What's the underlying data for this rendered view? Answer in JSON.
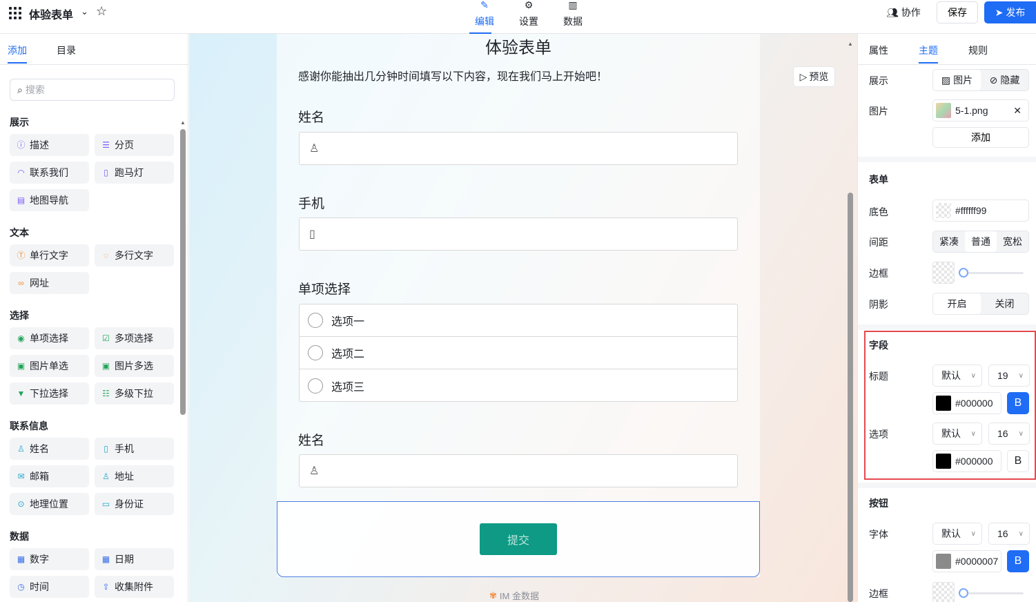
{
  "header": {
    "form_title": "体验表单",
    "tabs": [
      {
        "label": "编辑",
        "icon": "edit-icon"
      },
      {
        "label": "设置",
        "icon": "settings-icon"
      },
      {
        "label": "数据",
        "icon": "chart-icon"
      }
    ],
    "collab_label": "协作",
    "save_label": "保存",
    "publish_label": "发布"
  },
  "left": {
    "tabs": [
      "添加",
      "目录"
    ],
    "search_placeholder": "搜索",
    "sections": [
      {
        "title": "展示",
        "items": [
          {
            "label": "描述",
            "icon": "info-icon",
            "color": "#7c5cfc"
          },
          {
            "label": "分页",
            "icon": "page-break-icon",
            "color": "#7c5cfc"
          },
          {
            "label": "联系我们",
            "icon": "headset-icon",
            "color": "#7c5cfc"
          },
          {
            "label": "跑马灯",
            "icon": "carousel-icon",
            "color": "#7c5cfc"
          },
          {
            "label": "地图导航",
            "icon": "map-icon",
            "color": "#7c5cfc"
          }
        ]
      },
      {
        "title": "文本",
        "items": [
          {
            "label": "单行文字",
            "icon": "text-icon",
            "color": "#f0913c"
          },
          {
            "label": "多行文字",
            "icon": "chat-icon",
            "color": "#f0913c"
          },
          {
            "label": "网址",
            "icon": "link-icon",
            "color": "#f0913c"
          }
        ]
      },
      {
        "title": "选择",
        "items": [
          {
            "label": "单项选择",
            "icon": "radio-icon",
            "color": "#22a55a"
          },
          {
            "label": "多项选择",
            "icon": "checkbox-icon",
            "color": "#22a55a"
          },
          {
            "label": "图片单选",
            "icon": "image-radio-icon",
            "color": "#22a55a"
          },
          {
            "label": "图片多选",
            "icon": "image-check-icon",
            "color": "#22a55a"
          },
          {
            "label": "下拉选择",
            "icon": "dropdown-icon",
            "color": "#22a55a"
          },
          {
            "label": "多级下拉",
            "icon": "cascade-icon",
            "color": "#22a55a"
          }
        ]
      },
      {
        "title": "联系信息",
        "items": [
          {
            "label": "姓名",
            "icon": "user-icon",
            "color": "#1fa8c9"
          },
          {
            "label": "手机",
            "icon": "phone-icon",
            "color": "#1fa8c9"
          },
          {
            "label": "邮箱",
            "icon": "mail-icon",
            "color": "#1fa8c9"
          },
          {
            "label": "地址",
            "icon": "address-icon",
            "color": "#1fa8c9"
          },
          {
            "label": "地理位置",
            "icon": "location-icon",
            "color": "#1fa8c9"
          },
          {
            "label": "身份证",
            "icon": "id-card-icon",
            "color": "#1fa8c9"
          }
        ]
      },
      {
        "title": "数据",
        "items": [
          {
            "label": "数字",
            "icon": "number-icon",
            "color": "#3a6ee8"
          },
          {
            "label": "日期",
            "icon": "calendar-icon",
            "color": "#3a6ee8"
          },
          {
            "label": "时间",
            "icon": "clock-icon",
            "color": "#3a6ee8"
          },
          {
            "label": "收集附件",
            "icon": "upload-icon",
            "color": "#3a6ee8"
          }
        ]
      }
    ]
  },
  "canvas": {
    "title": "体验表单",
    "description": "感谢你能抽出几分钟时间填写以下内容，现在我们马上开始吧！",
    "preview_label": "预览",
    "fields": {
      "name1": "姓名",
      "phone": "手机",
      "choice": "单项选择",
      "name2": "姓名"
    },
    "options": [
      "选项一",
      "选项二",
      "选项三"
    ],
    "submit_label": "提交",
    "brand": "IM 金数据",
    "submit_color": "#0e9a84"
  },
  "right": {
    "tabs": [
      "属性",
      "主题",
      "规则"
    ],
    "display_label": "展示",
    "display_options": [
      "图片",
      "隐藏"
    ],
    "image_label": "图片",
    "image_file": "5-1.png",
    "add_label": "添加",
    "form_section": "表单",
    "bg_label": "底色",
    "bg_value": "#ffffff99",
    "spacing_label": "间距",
    "spacing_options": [
      "紧凑",
      "普通",
      "宽松"
    ],
    "border_label": "边框",
    "shadow_label": "阴影",
    "shadow_options": [
      "开启",
      "关闭"
    ],
    "field_section": "字段",
    "title_label": "标题",
    "title_font": "默认",
    "title_size": "19",
    "title_color": "#000000",
    "option_label": "选项",
    "option_font": "默认",
    "option_size": "16",
    "option_color": "#000000",
    "bold_label": "B",
    "button_section": "按钮",
    "font_label": "字体",
    "button_font": "默认",
    "button_size": "16",
    "button_color": "#0000007",
    "button_border_label": "边框"
  }
}
